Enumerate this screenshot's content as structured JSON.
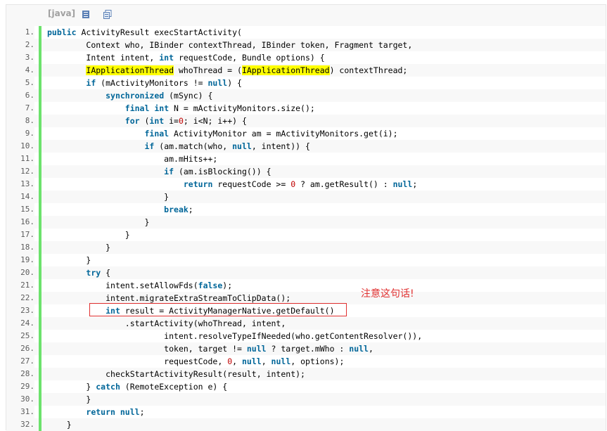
{
  "toolbar": {
    "language": "[java]",
    "icons": [
      "view-source-icon",
      "copy-icon"
    ]
  },
  "annotation": {
    "note": "注意这句话!",
    "color": "#e03030"
  },
  "lines": [
    {
      "n": "1.",
      "indent": 0,
      "tokens": [
        [
          "kw",
          "public"
        ],
        [
          "t",
          " ActivityResult execStartActivity("
        ]
      ]
    },
    {
      "n": "2.",
      "indent": 8,
      "tokens": [
        [
          "t",
          "Context who, IBinder contextThread, IBinder token, Fragment target,"
        ]
      ]
    },
    {
      "n": "3.",
      "indent": 8,
      "tokens": [
        [
          "t",
          "Intent intent, "
        ],
        [
          "kw",
          "int"
        ],
        [
          "t",
          " requestCode, Bundle options) {"
        ]
      ]
    },
    {
      "n": "4.",
      "indent": 8,
      "tokens": [
        [
          "hl",
          "IApplicationThread"
        ],
        [
          "t",
          " whoThread = ("
        ],
        [
          "hl",
          "IApplicationThread"
        ],
        [
          "t",
          ") contextThread;"
        ]
      ]
    },
    {
      "n": "5.",
      "indent": 8,
      "tokens": [
        [
          "kw",
          "if"
        ],
        [
          "t",
          " (mActivityMonitors != "
        ],
        [
          "kw",
          "null"
        ],
        [
          "t",
          ") {"
        ]
      ]
    },
    {
      "n": "6.",
      "indent": 12,
      "tokens": [
        [
          "kw",
          "synchronized"
        ],
        [
          "t",
          " (mSync) {"
        ]
      ]
    },
    {
      "n": "7.",
      "indent": 16,
      "tokens": [
        [
          "kw",
          "final"
        ],
        [
          "t",
          " "
        ],
        [
          "kw",
          "int"
        ],
        [
          "t",
          " N = mActivityMonitors.size();"
        ]
      ]
    },
    {
      "n": "8.",
      "indent": 16,
      "tokens": [
        [
          "kw",
          "for"
        ],
        [
          "t",
          " ("
        ],
        [
          "kw",
          "int"
        ],
        [
          "t",
          " i="
        ],
        [
          "num",
          "0"
        ],
        [
          "t",
          "; i<N; i++) {"
        ]
      ]
    },
    {
      "n": "9.",
      "indent": 20,
      "tokens": [
        [
          "kw",
          "final"
        ],
        [
          "t",
          " ActivityMonitor am = mActivityMonitors.get(i);"
        ]
      ]
    },
    {
      "n": "10.",
      "indent": 20,
      "tokens": [
        [
          "kw",
          "if"
        ],
        [
          "t",
          " (am.match(who, "
        ],
        [
          "kw",
          "null"
        ],
        [
          "t",
          ", intent)) {"
        ]
      ]
    },
    {
      "n": "11.",
      "indent": 24,
      "tokens": [
        [
          "t",
          "am.mHits++;"
        ]
      ]
    },
    {
      "n": "12.",
      "indent": 24,
      "tokens": [
        [
          "kw",
          "if"
        ],
        [
          "t",
          " (am.isBlocking()) {"
        ]
      ]
    },
    {
      "n": "13.",
      "indent": 28,
      "tokens": [
        [
          "kw",
          "return"
        ],
        [
          "t",
          " requestCode >= "
        ],
        [
          "num",
          "0"
        ],
        [
          "t",
          " ? am.getResult() : "
        ],
        [
          "kw",
          "null"
        ],
        [
          "t",
          ";"
        ]
      ]
    },
    {
      "n": "14.",
      "indent": 24,
      "tokens": [
        [
          "t",
          "}"
        ]
      ]
    },
    {
      "n": "15.",
      "indent": 24,
      "tokens": [
        [
          "kw",
          "break"
        ],
        [
          "t",
          ";"
        ]
      ]
    },
    {
      "n": "16.",
      "indent": 20,
      "tokens": [
        [
          "t",
          "}"
        ]
      ]
    },
    {
      "n": "17.",
      "indent": 16,
      "tokens": [
        [
          "t",
          "}"
        ]
      ]
    },
    {
      "n": "18.",
      "indent": 12,
      "tokens": [
        [
          "t",
          "}"
        ]
      ]
    },
    {
      "n": "19.",
      "indent": 8,
      "tokens": [
        [
          "t",
          "}"
        ]
      ]
    },
    {
      "n": "20.",
      "indent": 8,
      "tokens": [
        [
          "kw",
          "try"
        ],
        [
          "t",
          " {"
        ]
      ]
    },
    {
      "n": "21.",
      "indent": 12,
      "tokens": [
        [
          "t",
          "intent.setAllowFds("
        ],
        [
          "kw",
          "false"
        ],
        [
          "t",
          ");"
        ]
      ]
    },
    {
      "n": "22.",
      "indent": 12,
      "tokens": [
        [
          "t",
          "intent.migrateExtraStreamToClipData();"
        ]
      ]
    },
    {
      "n": "23.",
      "indent": 12,
      "tokens": [
        [
          "kw",
          "int"
        ],
        [
          "t",
          " result = ActivityManagerNative.getDefault()"
        ]
      ]
    },
    {
      "n": "24.",
      "indent": 16,
      "tokens": [
        [
          "t",
          ".startActivity(whoThread, intent,"
        ]
      ]
    },
    {
      "n": "25.",
      "indent": 24,
      "tokens": [
        [
          "t",
          "intent.resolveTypeIfNeeded(who.getContentResolver()),"
        ]
      ]
    },
    {
      "n": "26.",
      "indent": 24,
      "tokens": [
        [
          "t",
          "token, target != "
        ],
        [
          "kw",
          "null"
        ],
        [
          "t",
          " ? target.mWho : "
        ],
        [
          "kw",
          "null"
        ],
        [
          "t",
          ","
        ]
      ]
    },
    {
      "n": "27.",
      "indent": 24,
      "tokens": [
        [
          "t",
          "requestCode, "
        ],
        [
          "num",
          "0"
        ],
        [
          "t",
          ", "
        ],
        [
          "kw",
          "null"
        ],
        [
          "t",
          ", "
        ],
        [
          "kw",
          "null"
        ],
        [
          "t",
          ", options);"
        ]
      ]
    },
    {
      "n": "28.",
      "indent": 12,
      "tokens": [
        [
          "t",
          "checkStartActivityResult(result, intent);"
        ]
      ]
    },
    {
      "n": "29.",
      "indent": 8,
      "tokens": [
        [
          "t",
          "} "
        ],
        [
          "kw",
          "catch"
        ],
        [
          "t",
          " (RemoteException e) {"
        ]
      ]
    },
    {
      "n": "30.",
      "indent": 8,
      "tokens": [
        [
          "t",
          "}"
        ]
      ]
    },
    {
      "n": "31.",
      "indent": 8,
      "tokens": [
        [
          "kw",
          "return"
        ],
        [
          "t",
          " "
        ],
        [
          "kw",
          "null"
        ],
        [
          "t",
          ";"
        ]
      ]
    },
    {
      "n": "32.",
      "indent": 4,
      "tokens": [
        [
          "t",
          "}"
        ]
      ]
    }
  ]
}
